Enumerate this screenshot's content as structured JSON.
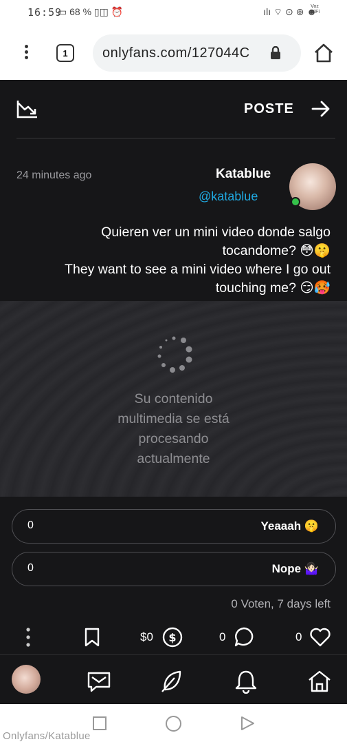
{
  "status_bar": {
    "time": "16:59",
    "battery_percent": "68",
    "left_icons_text": "▭ 68 %  ▯◫  ⏰",
    "right_icons_text": "ılı ⌔  ⊙ ⊚ ☻",
    "voz_label": "Voz WiFi"
  },
  "browser": {
    "url": "onlyfans.com/127044C",
    "tab_count": "1"
  },
  "post": {
    "header_title": "POSTE",
    "author_name": "Katablue",
    "author_handle": "@katablue",
    "timestamp": "24 minutes ago",
    "text_lines": [
      "Quieren ver un mini video donde salgo",
      "tocandome? 😳🤫",
      "They want to see a mini video where I go out",
      "touching me? 😏🥵"
    ],
    "media_message_lines": [
      "Su contenido",
      "multimedia se está",
      "procesando",
      "actualmente"
    ]
  },
  "poll": {
    "options": [
      {
        "label": "Yeaaah 🤫",
        "count": "0"
      },
      {
        "label": "Nope 🤷🏻‍♀️",
        "count": "0"
      }
    ],
    "summary": "0 Voten, 7 days left"
  },
  "actions": {
    "likes": "0",
    "comments": "0",
    "tips": "$0"
  },
  "bottom_nav": [
    "home-icon",
    "bell-icon",
    "feather-icon",
    "message-icon",
    "profile-avatar"
  ],
  "watermark": "Onlyfans/Katablue",
  "colors": {
    "background_dark": "#161618",
    "handle_blue": "#1fa8e0",
    "online_green": "#35c14a"
  }
}
